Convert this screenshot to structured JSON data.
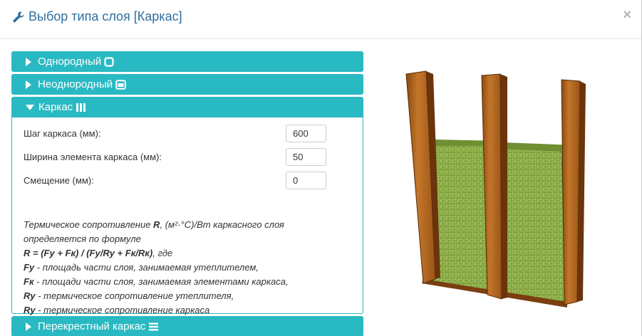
{
  "modal": {
    "title": "Выбор типа слоя [Каркас]",
    "close_label": "×"
  },
  "accordion": {
    "sections": [
      {
        "label": "Однородный",
        "icon": "square-outline-icon",
        "expanded": false
      },
      {
        "label": "Неоднородный",
        "icon": "window-maximize-icon",
        "expanded": false
      },
      {
        "label": "Каркас",
        "icon": "vertical-bars-icon",
        "expanded": true
      },
      {
        "label": "Перекрестный каркас",
        "icon": "horizontal-bars-icon",
        "expanded": false
      }
    ]
  },
  "frame": {
    "fields": [
      {
        "label": "Шаг каркаса (мм):",
        "value": "600"
      },
      {
        "label": "Ширина элемента каркаса (мм):",
        "value": "50"
      },
      {
        "label": "Смещение (мм):",
        "value": "0"
      }
    ],
    "description": {
      "intro_1": "Термическое сопротивление ",
      "intro_R": "R",
      "intro_2": ", (м²·°С)/Вт каркасного слоя",
      "intro_3": "определяется по формуле",
      "formula": "R = (Fy + Fк) / (Fy/Ry + Fк/Rк)",
      "formula_tail": ", где",
      "def1_term": "Fy",
      "def1_text": " - площадь части слоя, занимаемая утеплителем,",
      "def2_term": "Fк",
      "def2_text": " - площади части слоя, занимаемая элементами каркаса,",
      "def3_term": "Ry",
      "def3_text": " - термическое сопротивление утеплителя,",
      "def4_term": "Ry",
      "def4_text": " - термическое сопротивление каркаса"
    }
  },
  "colors": {
    "accent": "#29b9c2",
    "title": "#2f6f9f",
    "wood": "#b5651d",
    "insulation": "#8fb04a"
  }
}
